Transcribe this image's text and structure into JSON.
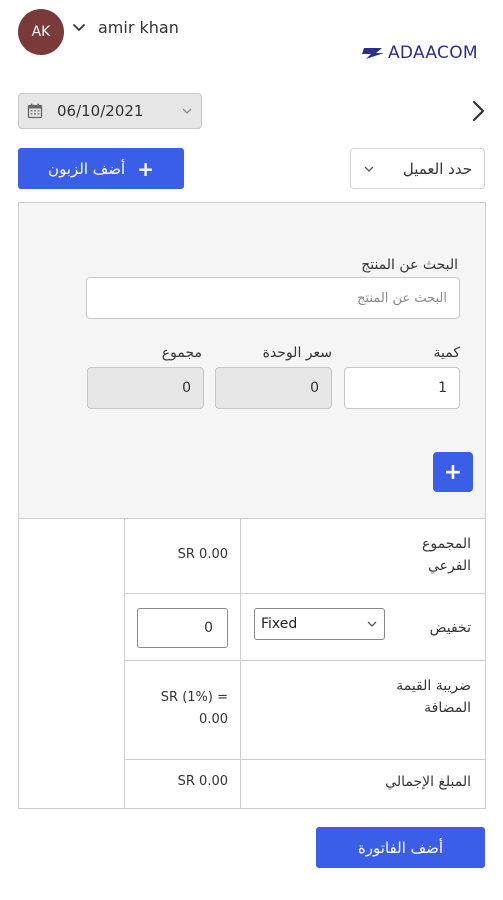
{
  "user": {
    "initials": "AK",
    "name": "amir khan"
  },
  "brand": {
    "name": "ADAACOM",
    "color": "#2a2f8f"
  },
  "accent": "#3b5ee8",
  "date": {
    "value": "06/10/2021"
  },
  "customer": {
    "add_label": "أضف الزبون",
    "select_label": "حدد العميل"
  },
  "product": {
    "search_label": "البحث عن المنتج",
    "search_placeholder": "البحث عن المنتج",
    "quantity_label": "كمية",
    "quantity_value": "1",
    "unit_price_label": "سعر الوحدة",
    "unit_price_value": "0",
    "total_label": "مجموع",
    "total_value": "0"
  },
  "summary": {
    "subtotal_label": "المجموع الفرعي",
    "subtotal_value": "SR 0.00",
    "discount_label": "تخفيض",
    "discount_type": "Fixed",
    "discount_value": "0",
    "vat_label": "ضريبة القيمة المضافة",
    "vat_value": "SR (1%) = 0.00",
    "grand_total_label": "المبلغ الإجمالي",
    "grand_total_value": "SR 0.00"
  },
  "invoice": {
    "add_label": "أضف الفاتورة"
  }
}
